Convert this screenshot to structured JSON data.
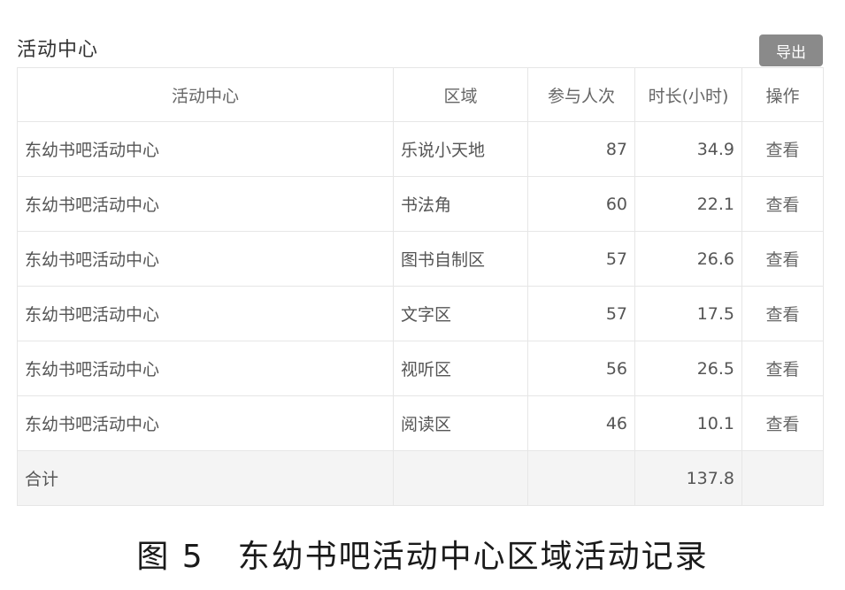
{
  "panel": {
    "title": "活动中心",
    "export_label": "导出"
  },
  "table": {
    "columns": [
      "活动中心",
      "区域",
      "参与人次",
      "时长(小时)",
      "操作"
    ],
    "rows": [
      {
        "center": "东幼书吧活动中心",
        "area": "乐说小天地",
        "visits": "87",
        "hours": "34.9",
        "action": "查看"
      },
      {
        "center": "东幼书吧活动中心",
        "area": "书法角",
        "visits": "60",
        "hours": "22.1",
        "action": "查看"
      },
      {
        "center": "东幼书吧活动中心",
        "area": "图书自制区",
        "visits": "57",
        "hours": "26.6",
        "action": "查看"
      },
      {
        "center": "东幼书吧活动中心",
        "area": "文字区",
        "visits": "57",
        "hours": "17.5",
        "action": "查看"
      },
      {
        "center": "东幼书吧活动中心",
        "area": "视听区",
        "visits": "56",
        "hours": "26.5",
        "action": "查看"
      },
      {
        "center": "东幼书吧活动中心",
        "area": "阅读区",
        "visits": "46",
        "hours": "10.1",
        "action": "查看"
      }
    ],
    "total": {
      "label": "合计",
      "hours": "137.8"
    }
  },
  "caption": "图 5　东幼书吧活动中心区域活动记录"
}
